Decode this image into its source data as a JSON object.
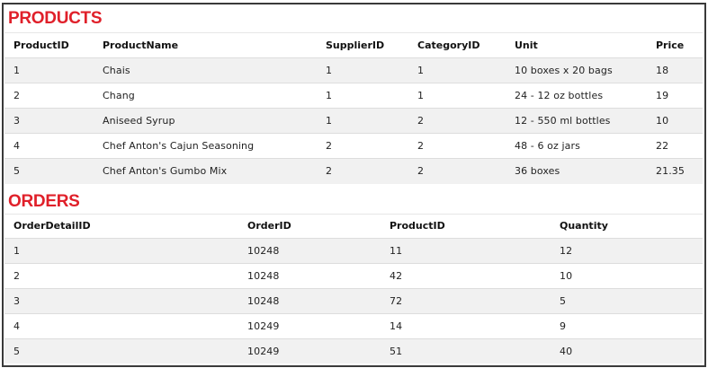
{
  "products": {
    "title": "PRODUCTS",
    "columns": [
      "ProductID",
      "ProductName",
      "SupplierID",
      "CategoryID",
      "Unit",
      "Price"
    ],
    "rows": [
      [
        "1",
        "Chais",
        "1",
        "1",
        "10 boxes x 20 bags",
        "18"
      ],
      [
        "2",
        "Chang",
        "1",
        "1",
        "24 - 12 oz bottles",
        "19"
      ],
      [
        "3",
        "Aniseed Syrup",
        "1",
        "2",
        "12 - 550 ml bottles",
        "10"
      ],
      [
        "4",
        "Chef Anton's Cajun Seasoning",
        "2",
        "2",
        "48 - 6 oz jars",
        "22"
      ],
      [
        "5",
        "Chef Anton's Gumbo Mix",
        "2",
        "2",
        "36 boxes",
        "21.35"
      ]
    ]
  },
  "orders": {
    "title": "ORDERS",
    "columns": [
      "OrderDetailID",
      "OrderID",
      "ProductID",
      "Quantity"
    ],
    "rows": [
      [
        "1",
        "10248",
        "11",
        "12"
      ],
      [
        "2",
        "10248",
        "42",
        "10"
      ],
      [
        "3",
        "10248",
        "72",
        "5"
      ],
      [
        "4",
        "10249",
        "14",
        "9"
      ],
      [
        "5",
        "10249",
        "51",
        "40"
      ]
    ]
  },
  "colors": {
    "title_red": "#e0202a",
    "stripe": "#f1f1f1",
    "border": "#3a3a3a"
  }
}
